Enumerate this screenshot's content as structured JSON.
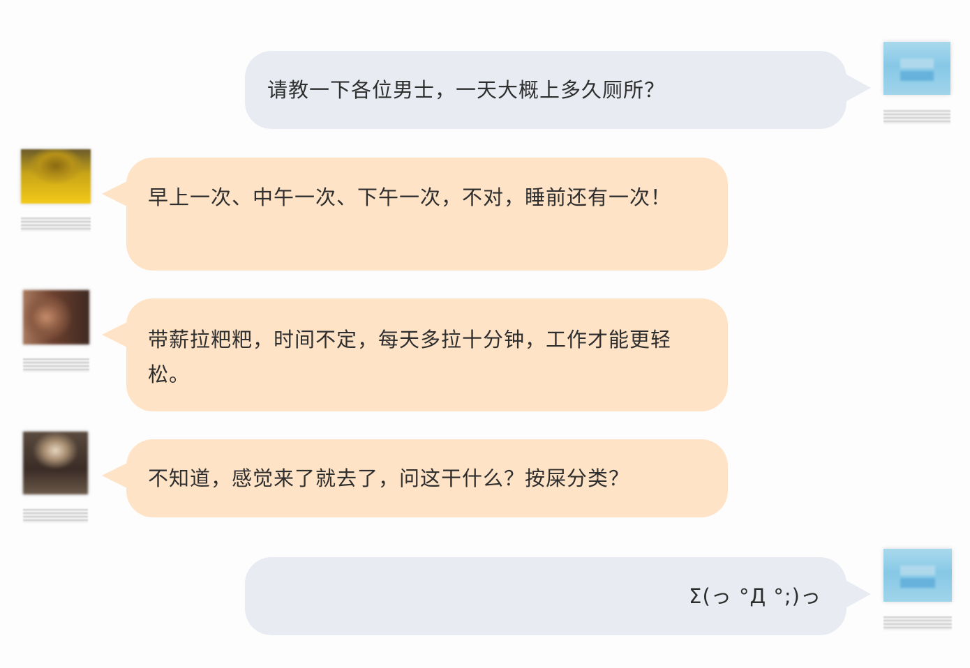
{
  "messages": [
    {
      "side": "right",
      "text": "请教一下各位男士，一天大概上多久厕所？"
    },
    {
      "side": "left",
      "text": "早上一次、中午一次、下午一次，不对，睡前还有一次！"
    },
    {
      "side": "left",
      "text": "带薪拉粑粑，时间不定，每天多拉十分钟，工作才能更轻松。"
    },
    {
      "side": "left",
      "text": "不知道，感觉来了就去了，问这干什么？按屎分类？"
    },
    {
      "side": "right",
      "text": "Σ(っ °Д °;)っ"
    }
  ],
  "colors": {
    "mine_bubble": "#e8ecf2",
    "their_bubble": "#ffe3c6",
    "text": "#2e2e2e"
  }
}
